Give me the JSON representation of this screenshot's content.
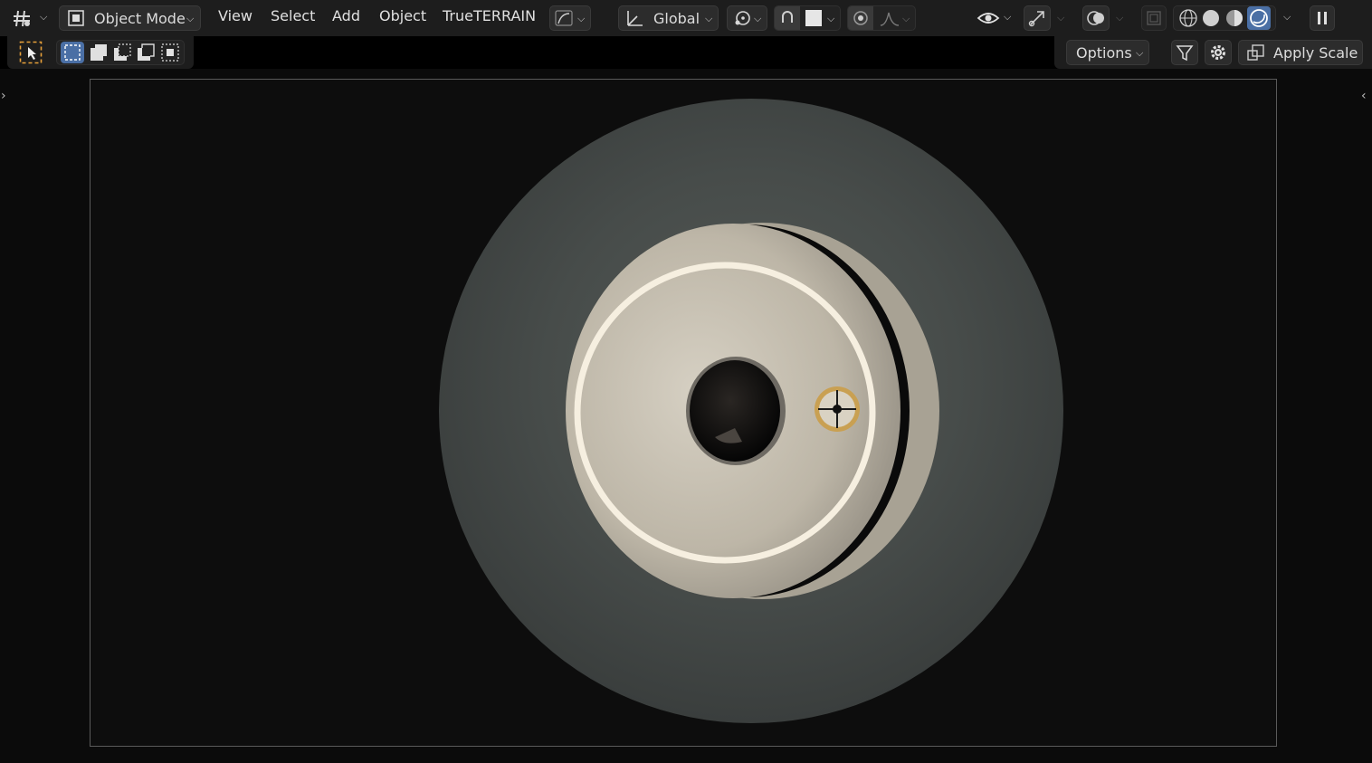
{
  "header": {
    "editor_type_icon": "grid-axes-icon",
    "mode_label": "Object Mode",
    "menus": [
      "View",
      "Select",
      "Add",
      "Object",
      "TrueTERRAIN"
    ],
    "transform_orientation": "Global"
  },
  "tool_settings": {
    "options_label": "Options",
    "apply_scale_label": "Apply Scale"
  },
  "icons": {
    "select_tool": "cursor-select-icon",
    "selection_modes": [
      "box-new-icon",
      "box-extend-icon",
      "box-subtract-icon",
      "box-invert-icon",
      "box-intersect-icon"
    ],
    "shading_modes": [
      "wireframe-shading-icon",
      "solid-shading-icon",
      "material-shading-icon",
      "rendered-shading-icon"
    ]
  },
  "colors": {
    "header_bg": "#1d1d1d",
    "accent_blue": "#4a6fa5",
    "selection_orange": "#e8a13a",
    "viewport_bg": "#0d0d0d"
  }
}
